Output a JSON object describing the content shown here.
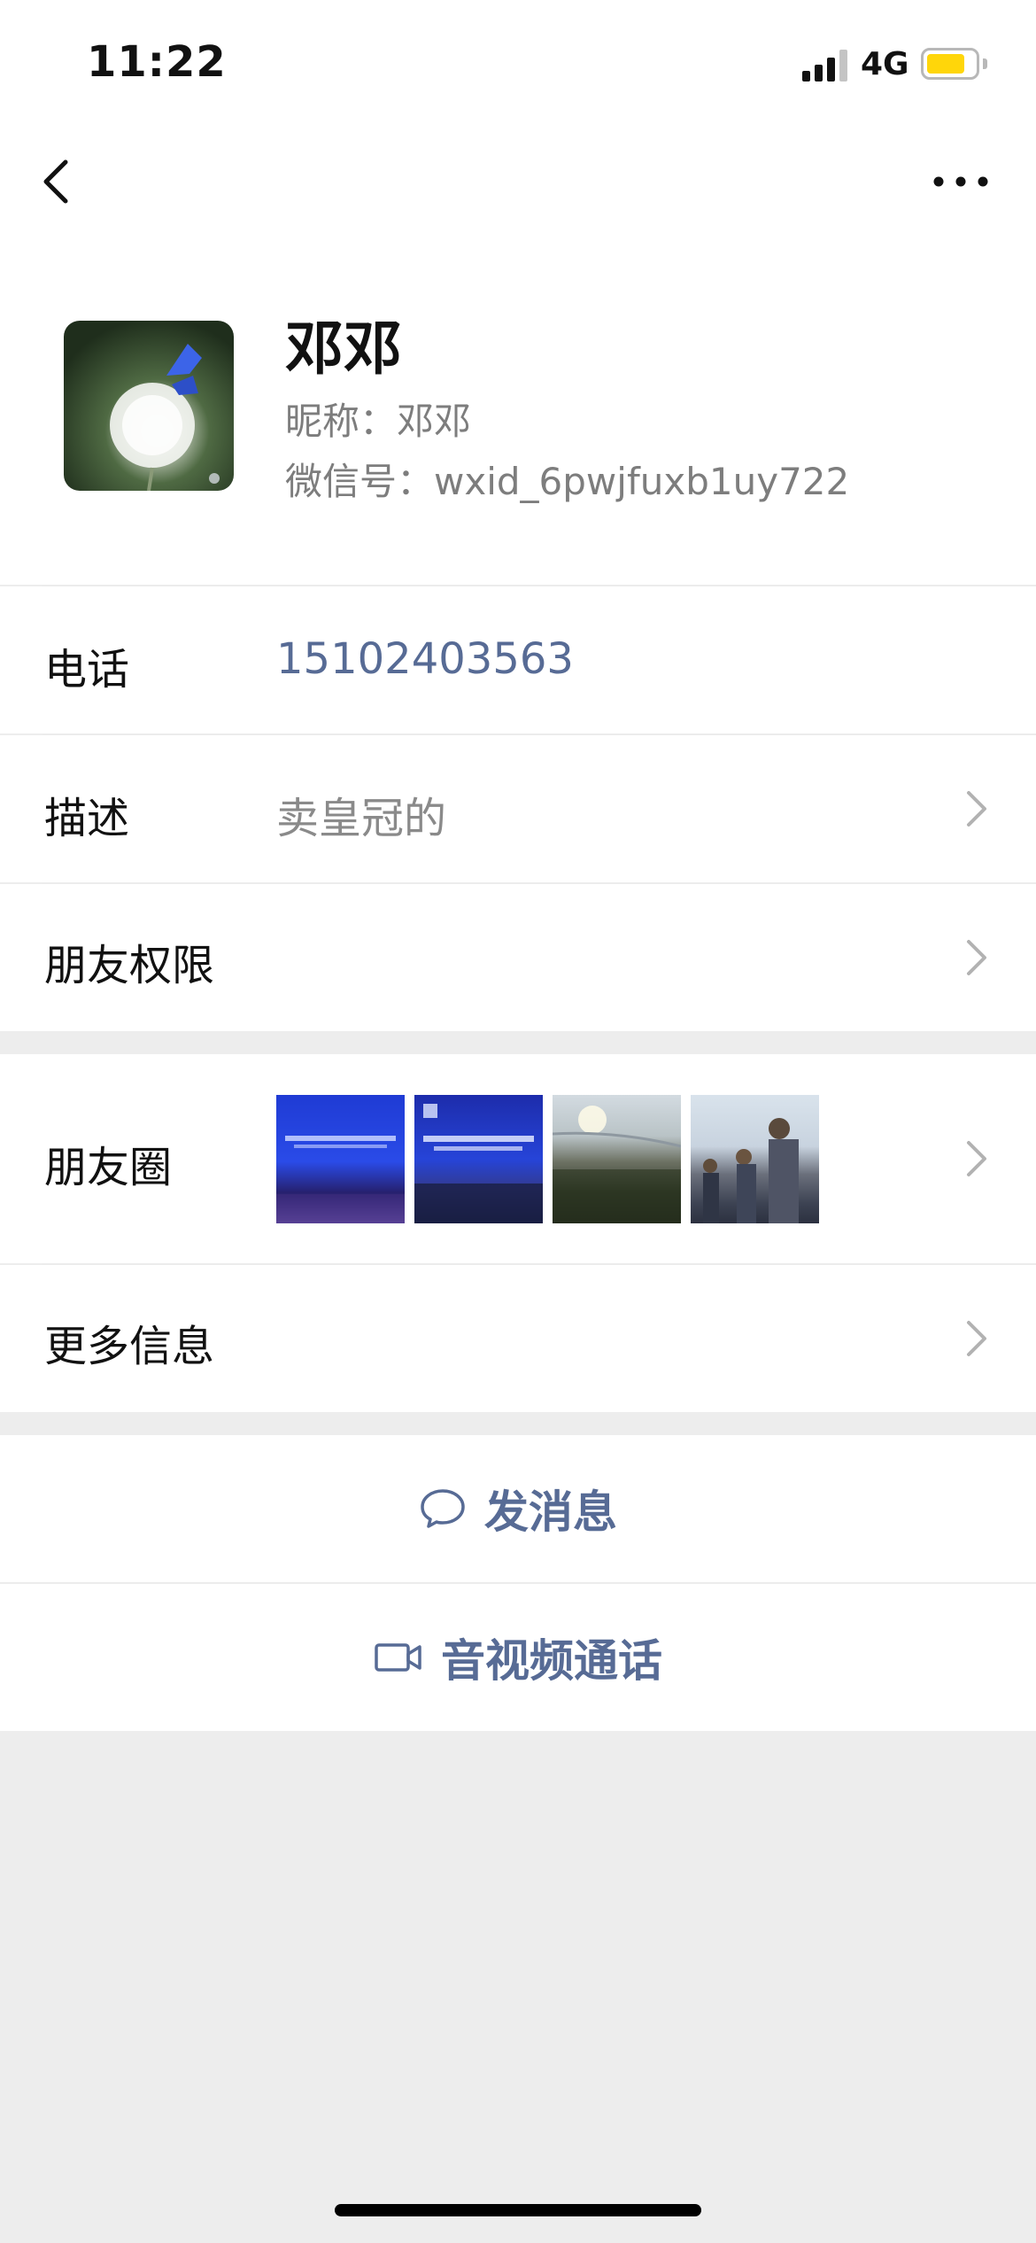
{
  "status_bar": {
    "time": "11:22",
    "network": "4G",
    "battery_color": "#ffd60a"
  },
  "nav": {
    "back_icon": "chevron-left-icon",
    "more_icon": "ellipsis-icon"
  },
  "profile": {
    "name": "邓邓",
    "nickname_label": "昵称：",
    "nickname": "邓邓",
    "wxid_label": "微信号：",
    "wxid": "wxid_6pwjfuxb1uy722"
  },
  "rows": {
    "phone_label": "电话",
    "phone_value": "15102403563",
    "description_label": "描述",
    "description_value": "卖皇冠的",
    "permissions_label": "朋友权限",
    "moments_label": "朋友圈",
    "more_info_label": "更多信息"
  },
  "actions": {
    "message_label": "发消息",
    "call_label": "音视频通话"
  },
  "colors": {
    "link_blue": "#576b95",
    "background": "#ededed",
    "secondary_text": "#7d7d7d"
  }
}
